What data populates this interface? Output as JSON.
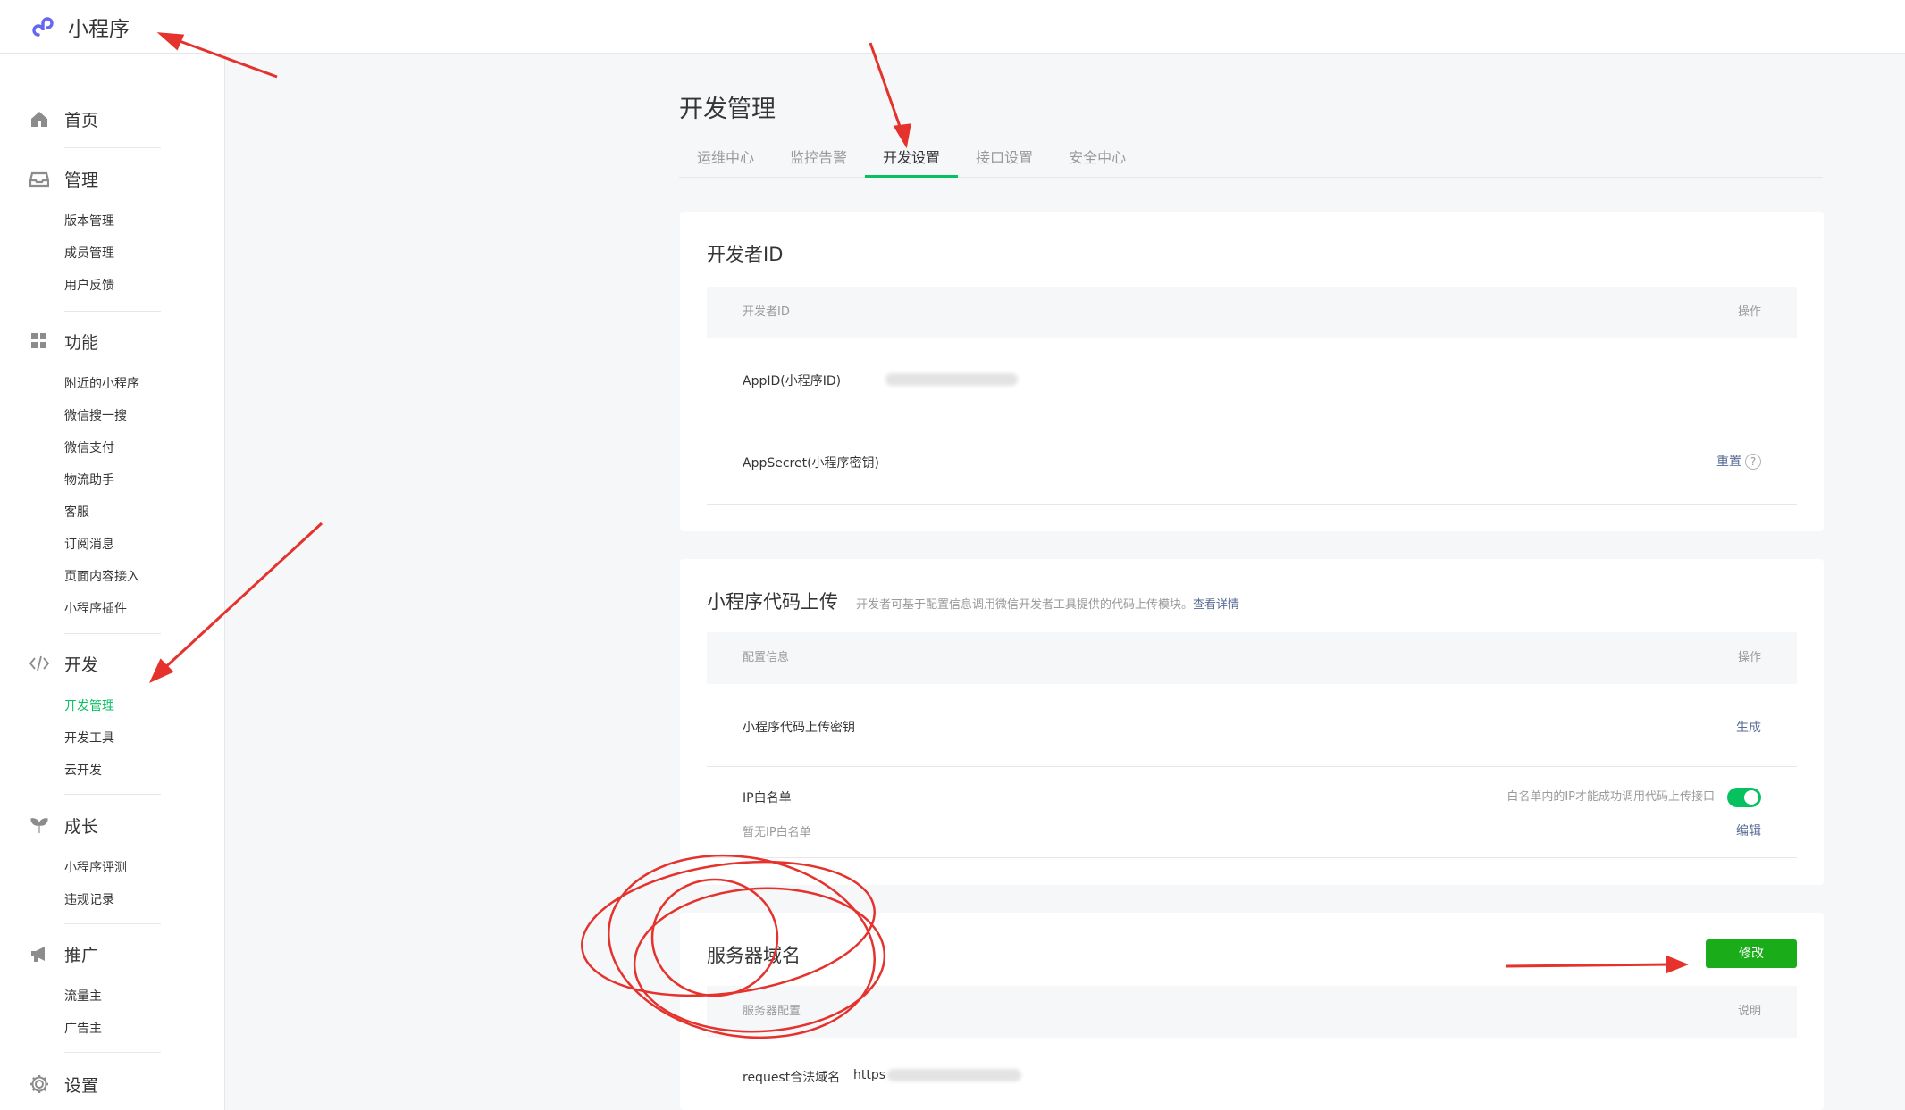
{
  "app": {
    "title": "小程序"
  },
  "sidebar": {
    "groups": [
      {
        "label": "首页",
        "icon": "home-icon",
        "items": []
      },
      {
        "label": "管理",
        "icon": "inbox-icon",
        "items": [
          "版本管理",
          "成员管理",
          "用户反馈"
        ]
      },
      {
        "label": "功能",
        "icon": "grid-icon",
        "items": [
          "附近的小程序",
          "微信搜一搜",
          "微信支付",
          "物流助手",
          "客服",
          "订阅消息",
          "页面内容接入",
          "小程序插件"
        ]
      },
      {
        "label": "开发",
        "icon": "code-icon",
        "items": [
          "开发管理",
          "开发工具",
          "云开发"
        ],
        "active_item": "开发管理"
      },
      {
        "label": "成长",
        "icon": "sprout-icon",
        "items": [
          "小程序评测",
          "违规记录"
        ]
      },
      {
        "label": "推广",
        "icon": "megaphone-icon",
        "items": [
          "流量主",
          "广告主"
        ]
      },
      {
        "label": "设置",
        "icon": "gear-icon",
        "items": []
      }
    ]
  },
  "main": {
    "title": "开发管理",
    "tabs": [
      {
        "label": "运维中心"
      },
      {
        "label": "监控告警"
      },
      {
        "label": "开发设置",
        "active": true
      },
      {
        "label": "接口设置"
      },
      {
        "label": "安全中心"
      }
    ],
    "developer_id": {
      "title": "开发者ID",
      "col_left": "开发者ID",
      "col_right": "操作",
      "appid_label": "AppID(小程序ID)",
      "secret_label": "AppSecret(小程序密钥)",
      "reset_label": "重置",
      "help_glyph": "?"
    },
    "code_upload": {
      "title": "小程序代码上传",
      "desc": "开发者可基于配置信息调用微信开发者工具提供的代码上传模块。",
      "detail_link": "查看详情",
      "col_left": "配置信息",
      "col_right": "操作",
      "key_label": "小程序代码上传密钥",
      "generate_label": "生成",
      "ip_label": "IP白名单",
      "ip_hint": "白名单内的IP才能成功调用代码上传接口",
      "ip_empty": "暂无IP白名单",
      "edit_label": "编辑",
      "ip_toggle_on": true
    },
    "server_domain": {
      "title": "服务器域名",
      "modify_label": "修改",
      "col_left": "服务器配置",
      "col_right": "说明",
      "request_label": "request合法域名",
      "request_value_prefix": "https"
    }
  },
  "colors": {
    "accent": "#07c160",
    "button_green": "#1aad19",
    "link": "#576b95",
    "annotation": "#e5322d"
  }
}
